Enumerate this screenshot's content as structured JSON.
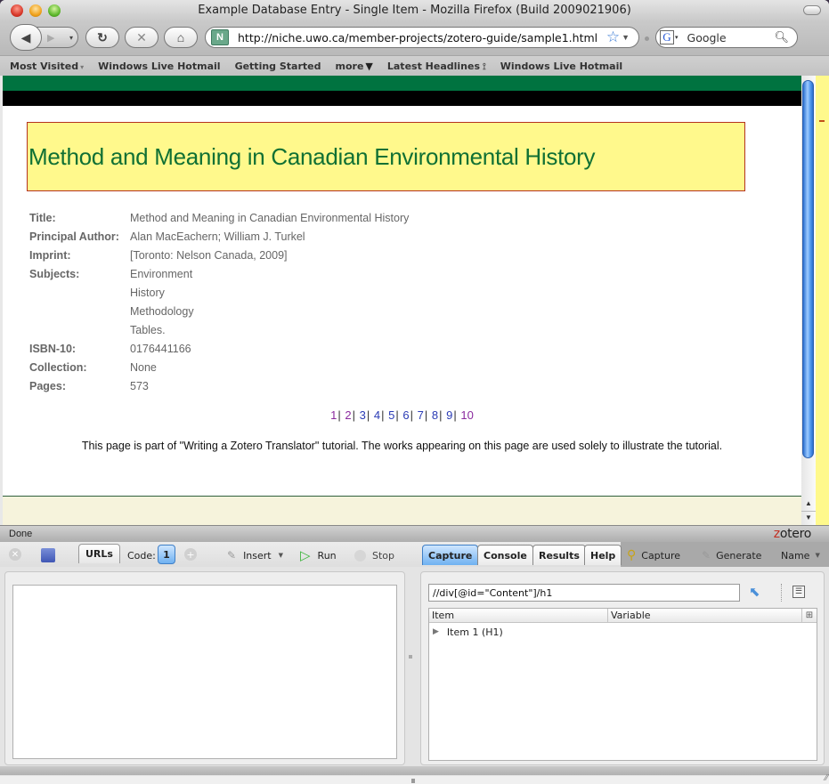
{
  "window": {
    "title": "Example Database Entry - Single Item - Mozilla Firefox (Build 2009021906)"
  },
  "navbar": {
    "back_icon": "◀",
    "forward_icon": "▶",
    "history_dropdown_icon": "▾",
    "reload_icon": "↻",
    "stop_icon": "✕",
    "home_icon": "⌂",
    "site_icon": "N",
    "url": "http://niche.uwo.ca/member-projects/zotero-guide/sample1.html",
    "bookmark_star_icon": "☆",
    "url_dropdown_icon": "▼",
    "search_engine_icon": "G",
    "search_engine_dropdown_icon": "▾",
    "search_placeholder": "Google",
    "search_icon": "🔍︎"
  },
  "bookmarks": [
    {
      "label": "Most Visited",
      "suffix": "▾"
    },
    {
      "label": "Windows Live Hotmail",
      "suffix": ""
    },
    {
      "label": "Getting Started",
      "suffix": ""
    },
    {
      "label": "more",
      "suffix": "▼"
    },
    {
      "label": "Latest Headlines",
      "suffix": "⟟"
    },
    {
      "label": "Windows Live Hotmail",
      "suffix": ""
    }
  ],
  "page": {
    "heading": "Method and Meaning in Canadian Environmental History",
    "fields": [
      {
        "label": "Title:",
        "values": [
          "Method and Meaning in Canadian Environmental History"
        ]
      },
      {
        "label": "Principal Author:",
        "values": [
          "Alan MacEachern; William J. Turkel"
        ]
      },
      {
        "label": "Imprint:",
        "values": [
          "[Toronto: Nelson Canada, 2009]"
        ]
      },
      {
        "label": "Subjects:",
        "values": [
          "Environment",
          "History",
          "Methodology",
          "Tables."
        ]
      },
      {
        "label": "ISBN-10:",
        "values": [
          "0176441166"
        ]
      },
      {
        "label": "Collection:",
        "values": [
          "None"
        ]
      },
      {
        "label": "Pages:",
        "values": [
          "573"
        ]
      }
    ],
    "pager": [
      {
        "label": "1",
        "visited": true
      },
      {
        "label": "2",
        "visited": true
      },
      {
        "label": "3",
        "visited": false
      },
      {
        "label": "4",
        "visited": false
      },
      {
        "label": "5",
        "visited": false
      },
      {
        "label": "6",
        "visited": false
      },
      {
        "label": "7",
        "visited": false
      },
      {
        "label": "8",
        "visited": false
      },
      {
        "label": "9",
        "visited": false
      },
      {
        "label": "10",
        "visited": true
      }
    ],
    "pager_separator": "|",
    "note": "This page is part of \"Writing a Zotero Translator\" tutorial. The works appearing on this page are used solely to illustrate the tutorial."
  },
  "scrollbar": {
    "up_icon": "▲",
    "down_icon": "▼"
  },
  "status": {
    "text": "Done",
    "logo_z": "z",
    "logo_rest": "otero"
  },
  "scaffold": {
    "toolbar": {
      "close_icon": "✕",
      "urls_tab": "URLs",
      "code_label": "Code:",
      "code_count": "1",
      "add_icon": "+",
      "insert_icon": "✎",
      "insert_label": "Insert",
      "insert_dropdown": "▼",
      "run_icon": "▷",
      "run_label": "Run",
      "stop_label": "Stop"
    },
    "right_tabs": [
      {
        "label": "Capture",
        "active": true
      },
      {
        "label": "Console",
        "active": false
      },
      {
        "label": "Results",
        "active": false
      },
      {
        "label": "Help",
        "active": false
      }
    ],
    "capture_icon": "⚲",
    "capture_label": "Capture",
    "generate_icon": "✎",
    "generate_label": "Generate",
    "name_label": "Name",
    "name_dropdown": "▼",
    "code_text": "",
    "xpath_value": "//div[@id=\"Content\"]/h1",
    "pointer_icon": "⬉",
    "list_icon": "☰",
    "tree": {
      "columns": [
        "Item",
        "Variable"
      ],
      "column_picker_icon": "⊞",
      "rows": [
        {
          "twisty": "▶",
          "label": "Item 1 (H1)"
        }
      ]
    },
    "resize_icon": "⁄⁄"
  }
}
